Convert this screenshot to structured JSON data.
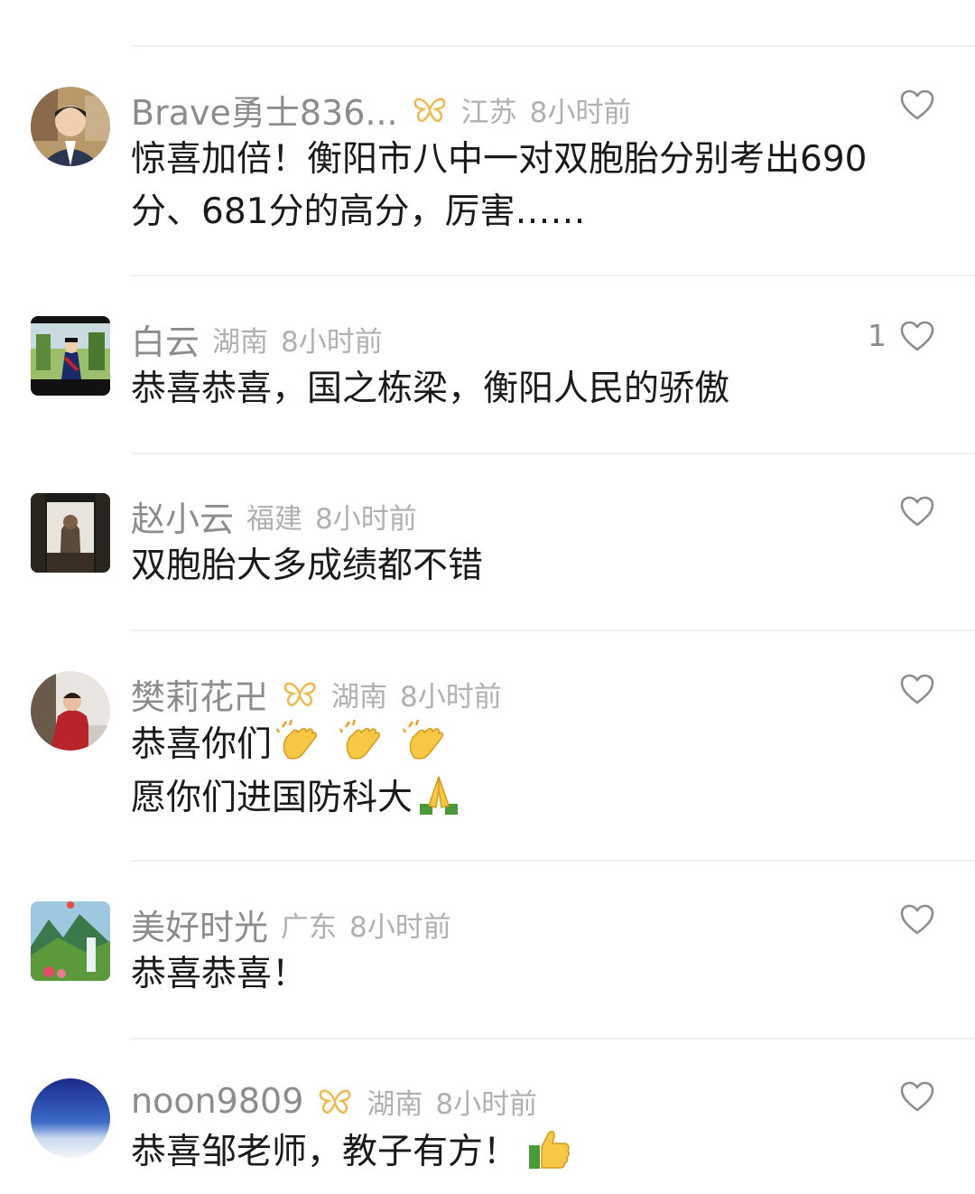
{
  "comments": [
    {
      "username": "Brave勇士836...",
      "location": "江苏",
      "time": "8小时前",
      "text_lines": [
        "惊喜加倍！衡阳市八中一对双胞胎分别考出690",
        "分、681分的高分，厉害……"
      ],
      "likes": ""
    },
    {
      "username": "白云",
      "location": "湖南",
      "time": "8小时前",
      "text_lines": [
        "恭喜恭喜，国之栋梁，衡阳人民的骄傲"
      ],
      "likes": "1"
    },
    {
      "username": "赵小云",
      "location": "福建",
      "time": "8小时前",
      "text_lines": [
        "双胞胎大多成绩都不错"
      ],
      "likes": ""
    },
    {
      "username": "樊莉花卍",
      "location": "湖南",
      "time": "8小时前",
      "text_lines": [
        "恭喜你们",
        "愿你们进国防科大"
      ],
      "likes": ""
    },
    {
      "username": "美好时光",
      "location": "广东",
      "time": "8小时前",
      "text_lines": [
        "恭喜恭喜！"
      ],
      "likes": ""
    },
    {
      "username": "noon9809",
      "location": "湖南",
      "time": "8小时前",
      "text_lines": [
        "恭喜邹老师，教子有方！"
      ],
      "likes": ""
    }
  ],
  "icons": {
    "badge": "butterfly-badge-icon",
    "like": "heart-icon",
    "clap": "clapping-hands-emoji",
    "pray": "folded-hands-emoji",
    "thumbs": "thumbs-up-emoji"
  },
  "colors": {
    "badge": "#f0b94a",
    "meta": "#b0b0b0",
    "text": "#1a1a1a"
  }
}
